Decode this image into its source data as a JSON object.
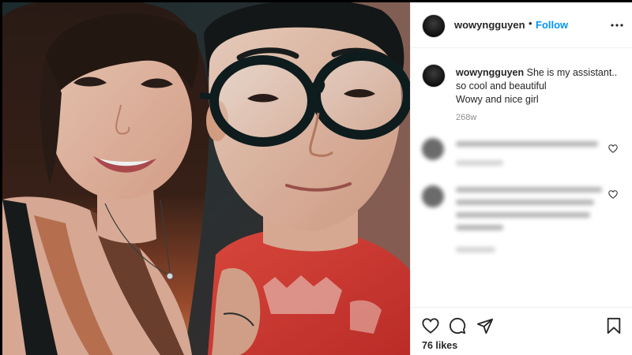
{
  "post": {
    "username": "wowyngguyen",
    "follow_label": "Follow",
    "header_separator": "•",
    "caption": {
      "username": "wowyngguyen",
      "text": "She is my assistant.. so cool and beautiful\nWowy and nice girl",
      "time": "268w"
    },
    "likes": "76 likes",
    "icons": {
      "more": "more-options-icon",
      "like": "heart-icon",
      "comment": "comment-icon",
      "share": "share-icon",
      "save": "bookmark-icon",
      "comment_like": "heart-icon"
    }
  },
  "colors": {
    "link_blue": "#0095f6",
    "text": "#262626",
    "muted": "#8e8e8e",
    "divider": "#efefef"
  }
}
